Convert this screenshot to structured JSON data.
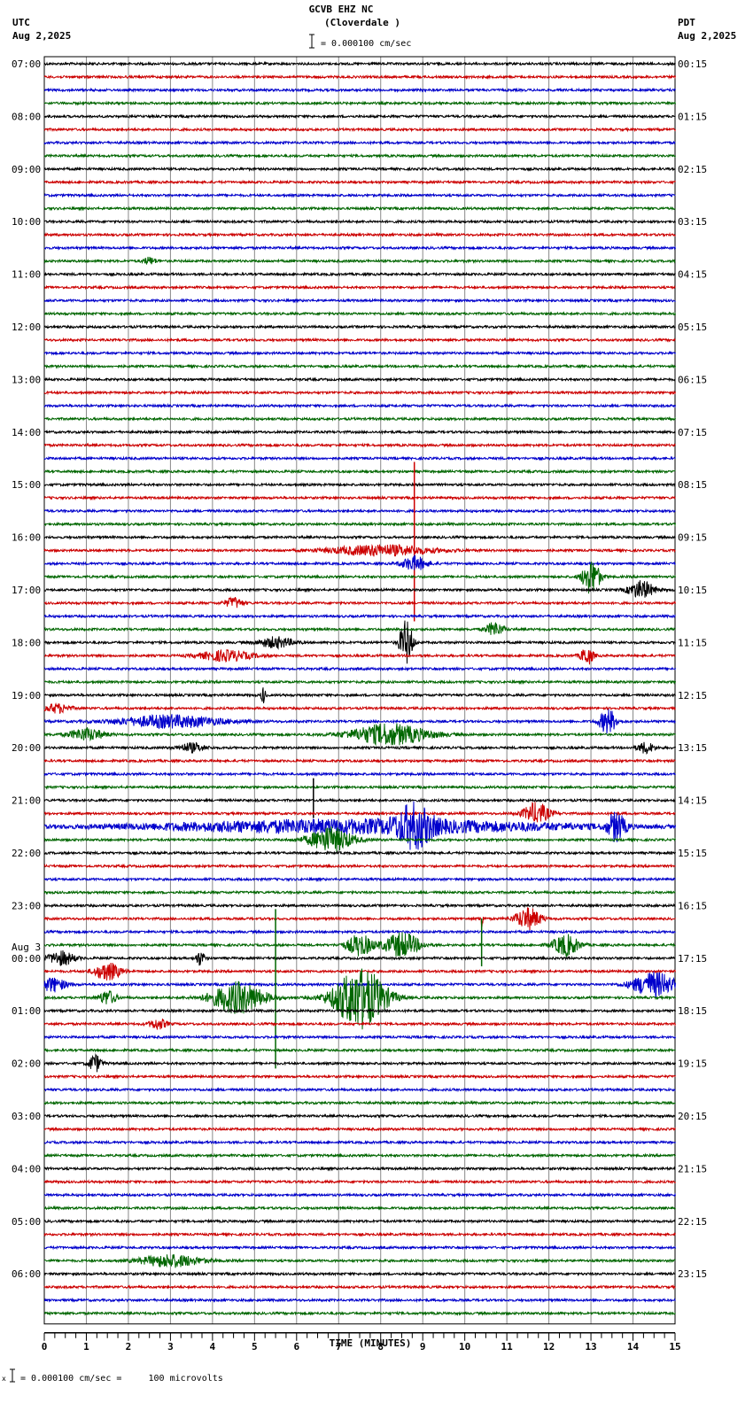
{
  "header": {
    "title": "GCVB EHZ NC",
    "subtitle": "(Cloverdale )",
    "left_tz": "UTC",
    "left_date": "Aug 2,2025",
    "right_tz": "PDT",
    "right_date": "Aug 2,2025",
    "scale_text": "= 0.000100 cm/sec"
  },
  "footer": {
    "scale_text": "= 0.000100 cm/sec =     100 microvolts"
  },
  "chart_data": {
    "type": "line",
    "title": "GCVB EHZ NC (Cloverdale )",
    "xlabel": "TIME (MINUTES)",
    "xlim": [
      0,
      15
    ],
    "x_ticks": [
      "0",
      "1",
      "2",
      "3",
      "4",
      "5",
      "6",
      "7",
      "8",
      "9",
      "10",
      "11",
      "12",
      "13",
      "14",
      "15"
    ],
    "traces_per_hour": 4,
    "trace_colors": [
      "#000000",
      "#cc0000",
      "#0000cc",
      "#006600"
    ],
    "day_change_label": "Aug 3",
    "day_change_row": 68,
    "utc_labels": [
      "07:00",
      "08:00",
      "09:00",
      "10:00",
      "11:00",
      "12:00",
      "13:00",
      "14:00",
      "15:00",
      "16:00",
      "17:00",
      "18:00",
      "19:00",
      "20:00",
      "21:00",
      "22:00",
      "23:00",
      "00:00",
      "01:00",
      "02:00",
      "03:00",
      "04:00",
      "05:00",
      "06:00"
    ],
    "pdt_labels": [
      "00:15",
      "01:15",
      "02:15",
      "03:15",
      "04:15",
      "05:15",
      "06:15",
      "07:15",
      "08:15",
      "09:15",
      "10:15",
      "11:15",
      "12:15",
      "13:15",
      "14:15",
      "15:15",
      "16:15",
      "17:15",
      "18:15",
      "19:15",
      "20:15",
      "21:15",
      "22:15",
      "23:15"
    ],
    "events": [
      {
        "row": 15,
        "minute": 2.5,
        "width": 0.15,
        "amp": 4
      },
      {
        "row": 37,
        "minute": 8.0,
        "width": 1.2,
        "amp": 6
      },
      {
        "row": 37,
        "minute": 8.8,
        "width": 0.05,
        "amp": 100,
        "spike": true
      },
      {
        "row": 38,
        "minute": 8.8,
        "width": 0.3,
        "amp": 8
      },
      {
        "row": 39,
        "minute": 13.0,
        "width": 0.2,
        "amp": 20
      },
      {
        "row": 40,
        "minute": 14.2,
        "width": 0.3,
        "amp": 10
      },
      {
        "row": 41,
        "minute": 4.5,
        "width": 0.2,
        "amp": 6
      },
      {
        "row": 43,
        "minute": 10.7,
        "width": 0.2,
        "amp": 8
      },
      {
        "row": 44,
        "minute": 8.6,
        "width": 0.15,
        "amp": 25
      },
      {
        "row": 44,
        "minute": 5.5,
        "width": 0.4,
        "amp": 6
      },
      {
        "row": 45,
        "minute": 12.9,
        "width": 0.15,
        "amp": 10
      },
      {
        "row": 45,
        "minute": 4.3,
        "width": 0.6,
        "amp": 6
      },
      {
        "row": 48,
        "minute": 5.2,
        "width": 0.05,
        "amp": 10
      },
      {
        "row": 49,
        "minute": 0.3,
        "width": 0.3,
        "amp": 5
      },
      {
        "row": 50,
        "minute": 3.0,
        "width": 1.2,
        "amp": 7
      },
      {
        "row": 50,
        "minute": 13.4,
        "width": 0.2,
        "amp": 14
      },
      {
        "row": 51,
        "minute": 8.2,
        "width": 0.9,
        "amp": 12
      },
      {
        "row": 51,
        "minute": 1.0,
        "width": 0.4,
        "amp": 7
      },
      {
        "row": 52,
        "minute": 3.5,
        "width": 0.3,
        "amp": 5
      },
      {
        "row": 52,
        "minute": 14.3,
        "width": 0.2,
        "amp": 6
      },
      {
        "row": 56,
        "minute": 6.4,
        "width": 0.05,
        "amp": 25,
        "spike": true
      },
      {
        "row": 57,
        "minute": 11.7,
        "width": 0.3,
        "amp": 12
      },
      {
        "row": 58,
        "minute": 7.5,
        "width": 5.0,
        "amp": 8
      },
      {
        "row": 58,
        "minute": 8.8,
        "width": 0.4,
        "amp": 20
      },
      {
        "row": 58,
        "minute": 13.6,
        "width": 0.2,
        "amp": 16
      },
      {
        "row": 59,
        "minute": 6.8,
        "width": 0.5,
        "amp": 14
      },
      {
        "row": 65,
        "minute": 11.5,
        "width": 0.3,
        "amp": 12
      },
      {
        "row": 65,
        "minute": 10.4,
        "width": 0.05,
        "amp": 10
      },
      {
        "row": 67,
        "minute": 8.5,
        "width": 0.4,
        "amp": 14
      },
      {
        "row": 67,
        "minute": 10.4,
        "width": 0.1,
        "amp": 30,
        "spike": true
      },
      {
        "row": 67,
        "minute": 12.4,
        "width": 0.3,
        "amp": 12
      },
      {
        "row": 67,
        "minute": 7.5,
        "width": 0.3,
        "amp": 12
      },
      {
        "row": 68,
        "minute": 0.4,
        "width": 0.3,
        "amp": 8
      },
      {
        "row": 68,
        "minute": 3.7,
        "width": 0.1,
        "amp": 8
      },
      {
        "row": 69,
        "minute": 1.5,
        "width": 0.3,
        "amp": 10
      },
      {
        "row": 70,
        "minute": 14.5,
        "width": 0.5,
        "amp": 14
      },
      {
        "row": 70,
        "minute": 0.2,
        "width": 0.3,
        "amp": 8
      },
      {
        "row": 71,
        "minute": 5.5,
        "width": 0.05,
        "amp": 100,
        "spike": true
      },
      {
        "row": 71,
        "minute": 4.6,
        "width": 0.6,
        "amp": 18
      },
      {
        "row": 71,
        "minute": 7.5,
        "width": 0.6,
        "amp": 35
      },
      {
        "row": 71,
        "minute": 1.5,
        "width": 0.2,
        "amp": 8
      },
      {
        "row": 73,
        "minute": 2.7,
        "width": 0.2,
        "amp": 6
      },
      {
        "row": 76,
        "minute": 1.2,
        "width": 0.15,
        "amp": 10
      },
      {
        "row": 91,
        "minute": 3.0,
        "width": 0.7,
        "amp": 7
      }
    ]
  }
}
